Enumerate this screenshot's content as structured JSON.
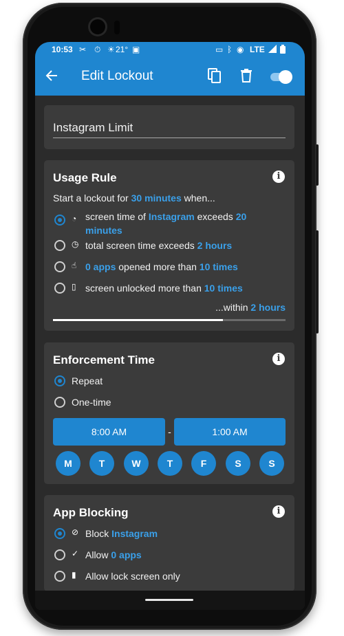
{
  "status": {
    "time": "10:53",
    "temp": "21°",
    "network": "LTE"
  },
  "appbar": {
    "title": "Edit Lockout",
    "back_icon": "arrow-left-icon",
    "copy_icon": "copy-icon",
    "delete_icon": "trash-icon",
    "toggle_on": true,
    "accent": "#1f86d0"
  },
  "name_field": {
    "value": "Instagram Limit"
  },
  "usage_rule": {
    "title": "Usage Rule",
    "intro_prefix": "Start a lockout for ",
    "intro_value": "30 minutes",
    "intro_suffix": " when...",
    "options": [
      {
        "prefix": "screen time of ",
        "app": "Instagram",
        "middle": " exceeds ",
        "value": "20",
        "value2": "minutes",
        "selected": true,
        "icon": "pie-chart-icon"
      },
      {
        "prefix": "total screen time exceeds ",
        "value": "2 hours",
        "selected": false,
        "icon": "clock-icon"
      },
      {
        "value_first": "0 apps",
        "middle": " opened more than ",
        "value": "10 times",
        "selected": false,
        "icon": "touch-icon"
      },
      {
        "prefix": "screen unlocked more than ",
        "value": "10 times",
        "selected": false,
        "icon": "unlock-phone-icon"
      }
    ],
    "within_prefix": "...within ",
    "within_value": "2 hours",
    "window_progress": 0.73
  },
  "enforcement": {
    "title": "Enforcement Time",
    "options": [
      {
        "label": "Repeat",
        "selected": true
      },
      {
        "label": "One-time",
        "selected": false
      }
    ],
    "start": "8:00 AM",
    "separator": "-",
    "end": "1:00 AM",
    "days": [
      "M",
      "T",
      "W",
      "T",
      "F",
      "S",
      "S"
    ]
  },
  "app_blocking": {
    "title": "App Blocking",
    "options": [
      {
        "prefix": "Block ",
        "value": "Instagram",
        "selected": true,
        "icon": "block-icon"
      },
      {
        "prefix": "Allow ",
        "value": "0 apps",
        "selected": false,
        "icon": "check-circle-icon"
      },
      {
        "prefix": "Allow lock screen only",
        "value": "",
        "selected": false,
        "icon": "phone-lock-icon"
      }
    ]
  }
}
